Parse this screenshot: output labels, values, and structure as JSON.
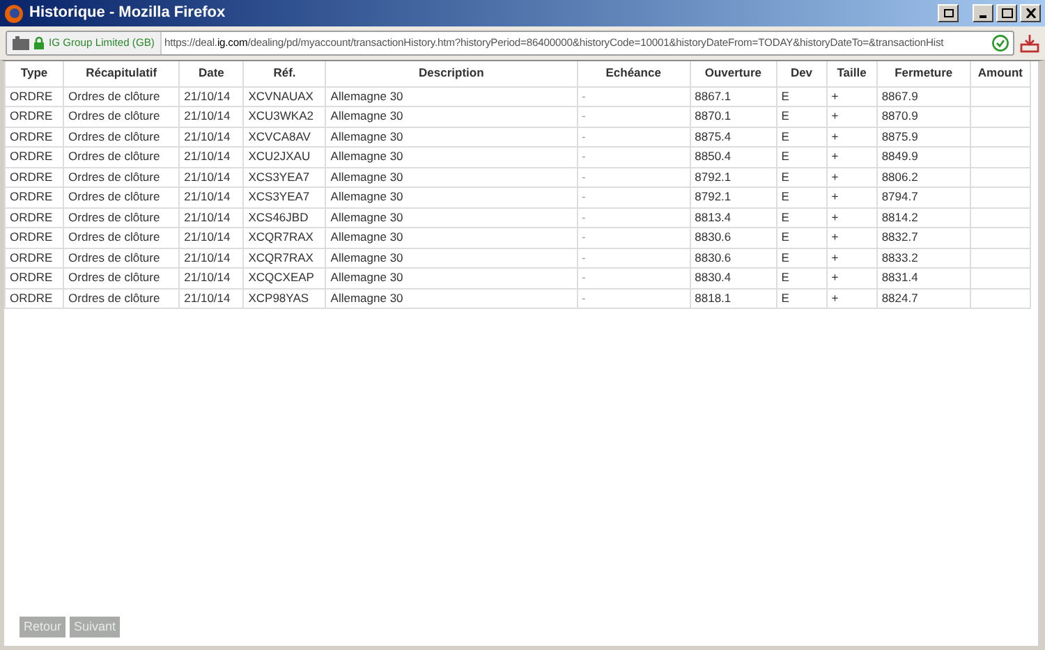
{
  "window": {
    "title": "Historique - Mozilla Firefox"
  },
  "address_bar": {
    "site_identity": "IG Group Limited (GB)",
    "url": "https://deal.**ig.com**/dealing/pd/myaccount/transactionHistory.htm?historyPeriod=86400000&historyCode=10001&historyDateFrom=TODAY&historyDateTo=&transactionHist"
  },
  "table": {
    "columns": [
      "Type",
      "Récapitulatif",
      "Date",
      "Réf.",
      "Description",
      "Echéance",
      "Ouverture",
      "Dev",
      "Taille",
      "Fermeture",
      "Amount"
    ],
    "rows": [
      [
        "ORDRE",
        "Ordres de clôture",
        "21/10/14",
        "XCVNAUAX",
        "Allemagne 30",
        "-",
        "8867.1",
        "E",
        "+",
        "8867.9",
        ""
      ],
      [
        "ORDRE",
        "Ordres de clôture",
        "21/10/14",
        "XCU3WKA2",
        "Allemagne 30",
        "-",
        "8870.1",
        "E",
        "+",
        "8870.9",
        ""
      ],
      [
        "ORDRE",
        "Ordres de clôture",
        "21/10/14",
        "XCVCA8AV",
        "Allemagne 30",
        "-",
        "8875.4",
        "E",
        "+",
        "8875.9",
        ""
      ],
      [
        "ORDRE",
        "Ordres de clôture",
        "21/10/14",
        "XCU2JXAU",
        "Allemagne 30",
        "-",
        "8850.4",
        "E",
        "+",
        "8849.9",
        ""
      ],
      [
        "ORDRE",
        "Ordres de clôture",
        "21/10/14",
        "XCS3YEA7",
        "Allemagne 30",
        "-",
        "8792.1",
        "E",
        "+",
        "8806.2",
        ""
      ],
      [
        "ORDRE",
        "Ordres de clôture",
        "21/10/14",
        "XCS3YEA7",
        "Allemagne 30",
        "-",
        "8792.1",
        "E",
        "+",
        "8794.7",
        ""
      ],
      [
        "ORDRE",
        "Ordres de clôture",
        "21/10/14",
        "XCS46JBD",
        "Allemagne 30",
        "-",
        "8813.4",
        "E",
        "+",
        "8814.2",
        ""
      ],
      [
        "ORDRE",
        "Ordres de clôture",
        "21/10/14",
        "XCQR7RAX",
        "Allemagne 30",
        "-",
        "8830.6",
        "E",
        "+",
        "8832.7",
        ""
      ],
      [
        "ORDRE",
        "Ordres de clôture",
        "21/10/14",
        "XCQR7RAX",
        "Allemagne 30",
        "-",
        "8830.6",
        "E",
        "+",
        "8833.2",
        ""
      ],
      [
        "ORDRE",
        "Ordres de clôture",
        "21/10/14",
        "XCQCXEAP",
        "Allemagne 30",
        "-",
        "8830.4",
        "E",
        "+",
        "8831.4",
        ""
      ],
      [
        "ORDRE",
        "Ordres de clôture",
        "21/10/14",
        "XCP98YAS",
        "Allemagne 30",
        "-",
        "8818.1",
        "E",
        "+",
        "8824.7",
        ""
      ]
    ]
  },
  "buttons": [
    {
      "label": "Retour",
      "disabled": true
    },
    {
      "label": "Suivant",
      "disabled": true
    }
  ]
}
